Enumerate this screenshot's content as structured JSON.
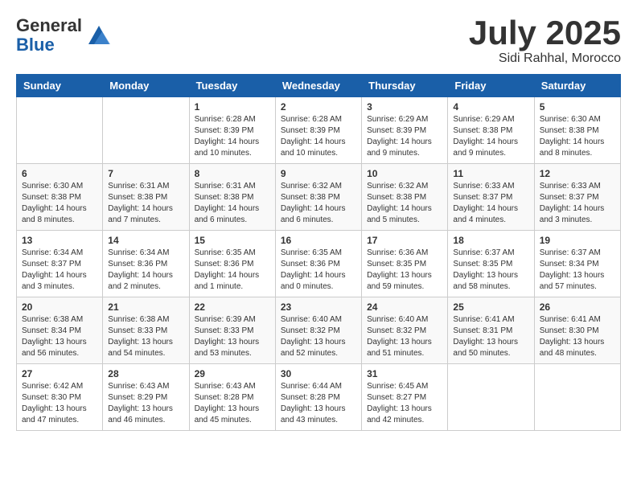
{
  "header": {
    "logo_line1": "General",
    "logo_line2": "Blue",
    "title": "July 2025",
    "location": "Sidi Rahhal, Morocco"
  },
  "weekdays": [
    "Sunday",
    "Monday",
    "Tuesday",
    "Wednesday",
    "Thursday",
    "Friday",
    "Saturday"
  ],
  "weeks": [
    [
      {
        "day": "",
        "info": ""
      },
      {
        "day": "",
        "info": ""
      },
      {
        "day": "1",
        "info": "Sunrise: 6:28 AM\nSunset: 8:39 PM\nDaylight: 14 hours and 10 minutes."
      },
      {
        "day": "2",
        "info": "Sunrise: 6:28 AM\nSunset: 8:39 PM\nDaylight: 14 hours and 10 minutes."
      },
      {
        "day": "3",
        "info": "Sunrise: 6:29 AM\nSunset: 8:39 PM\nDaylight: 14 hours and 9 minutes."
      },
      {
        "day": "4",
        "info": "Sunrise: 6:29 AM\nSunset: 8:38 PM\nDaylight: 14 hours and 9 minutes."
      },
      {
        "day": "5",
        "info": "Sunrise: 6:30 AM\nSunset: 8:38 PM\nDaylight: 14 hours and 8 minutes."
      }
    ],
    [
      {
        "day": "6",
        "info": "Sunrise: 6:30 AM\nSunset: 8:38 PM\nDaylight: 14 hours and 8 minutes."
      },
      {
        "day": "7",
        "info": "Sunrise: 6:31 AM\nSunset: 8:38 PM\nDaylight: 14 hours and 7 minutes."
      },
      {
        "day": "8",
        "info": "Sunrise: 6:31 AM\nSunset: 8:38 PM\nDaylight: 14 hours and 6 minutes."
      },
      {
        "day": "9",
        "info": "Sunrise: 6:32 AM\nSunset: 8:38 PM\nDaylight: 14 hours and 6 minutes."
      },
      {
        "day": "10",
        "info": "Sunrise: 6:32 AM\nSunset: 8:38 PM\nDaylight: 14 hours and 5 minutes."
      },
      {
        "day": "11",
        "info": "Sunrise: 6:33 AM\nSunset: 8:37 PM\nDaylight: 14 hours and 4 minutes."
      },
      {
        "day": "12",
        "info": "Sunrise: 6:33 AM\nSunset: 8:37 PM\nDaylight: 14 hours and 3 minutes."
      }
    ],
    [
      {
        "day": "13",
        "info": "Sunrise: 6:34 AM\nSunset: 8:37 PM\nDaylight: 14 hours and 3 minutes."
      },
      {
        "day": "14",
        "info": "Sunrise: 6:34 AM\nSunset: 8:36 PM\nDaylight: 14 hours and 2 minutes."
      },
      {
        "day": "15",
        "info": "Sunrise: 6:35 AM\nSunset: 8:36 PM\nDaylight: 14 hours and 1 minute."
      },
      {
        "day": "16",
        "info": "Sunrise: 6:35 AM\nSunset: 8:36 PM\nDaylight: 14 hours and 0 minutes."
      },
      {
        "day": "17",
        "info": "Sunrise: 6:36 AM\nSunset: 8:35 PM\nDaylight: 13 hours and 59 minutes."
      },
      {
        "day": "18",
        "info": "Sunrise: 6:37 AM\nSunset: 8:35 PM\nDaylight: 13 hours and 58 minutes."
      },
      {
        "day": "19",
        "info": "Sunrise: 6:37 AM\nSunset: 8:34 PM\nDaylight: 13 hours and 57 minutes."
      }
    ],
    [
      {
        "day": "20",
        "info": "Sunrise: 6:38 AM\nSunset: 8:34 PM\nDaylight: 13 hours and 56 minutes."
      },
      {
        "day": "21",
        "info": "Sunrise: 6:38 AM\nSunset: 8:33 PM\nDaylight: 13 hours and 54 minutes."
      },
      {
        "day": "22",
        "info": "Sunrise: 6:39 AM\nSunset: 8:33 PM\nDaylight: 13 hours and 53 minutes."
      },
      {
        "day": "23",
        "info": "Sunrise: 6:40 AM\nSunset: 8:32 PM\nDaylight: 13 hours and 52 minutes."
      },
      {
        "day": "24",
        "info": "Sunrise: 6:40 AM\nSunset: 8:32 PM\nDaylight: 13 hours and 51 minutes."
      },
      {
        "day": "25",
        "info": "Sunrise: 6:41 AM\nSunset: 8:31 PM\nDaylight: 13 hours and 50 minutes."
      },
      {
        "day": "26",
        "info": "Sunrise: 6:41 AM\nSunset: 8:30 PM\nDaylight: 13 hours and 48 minutes."
      }
    ],
    [
      {
        "day": "27",
        "info": "Sunrise: 6:42 AM\nSunset: 8:30 PM\nDaylight: 13 hours and 47 minutes."
      },
      {
        "day": "28",
        "info": "Sunrise: 6:43 AM\nSunset: 8:29 PM\nDaylight: 13 hours and 46 minutes."
      },
      {
        "day": "29",
        "info": "Sunrise: 6:43 AM\nSunset: 8:28 PM\nDaylight: 13 hours and 45 minutes."
      },
      {
        "day": "30",
        "info": "Sunrise: 6:44 AM\nSunset: 8:28 PM\nDaylight: 13 hours and 43 minutes."
      },
      {
        "day": "31",
        "info": "Sunrise: 6:45 AM\nSunset: 8:27 PM\nDaylight: 13 hours and 42 minutes."
      },
      {
        "day": "",
        "info": ""
      },
      {
        "day": "",
        "info": ""
      }
    ]
  ]
}
